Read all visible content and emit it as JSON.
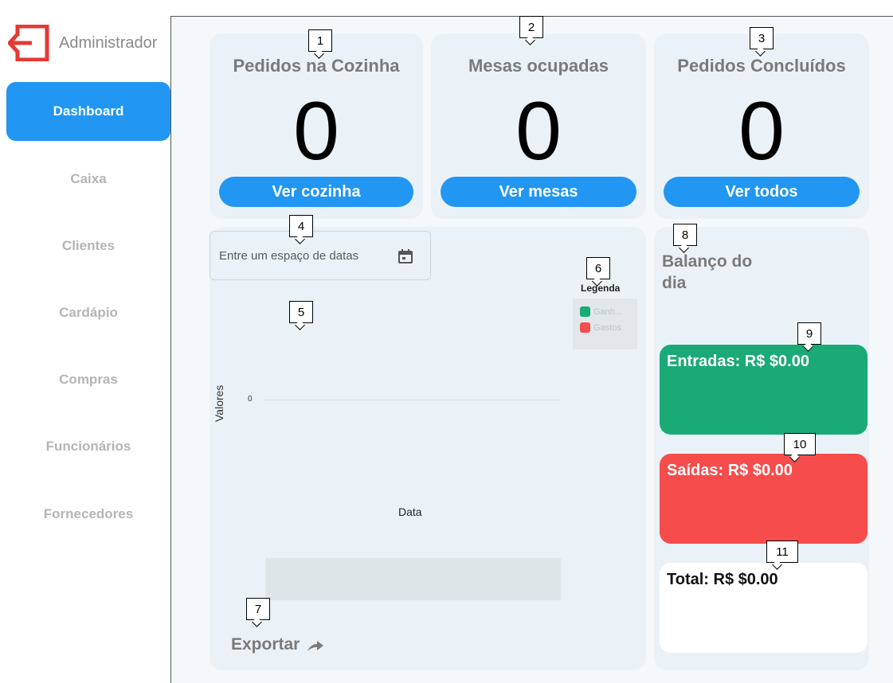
{
  "sidebar": {
    "title": "Administrador",
    "items": [
      {
        "label": "Dashboard",
        "active": true
      },
      {
        "label": "Caixa"
      },
      {
        "label": "Clientes"
      },
      {
        "label": "Cardápio"
      },
      {
        "label": "Compras"
      },
      {
        "label": "Funcionários"
      },
      {
        "label": "Fornecedores"
      }
    ],
    "icon": "logout-icon"
  },
  "cards": [
    {
      "title": "Pedidos na Cozinha",
      "value": "0",
      "button": "Ver cozinha"
    },
    {
      "title": "Mesas ocupadas",
      "value": "0",
      "button": "Ver mesas"
    },
    {
      "title": "Pedidos Concluídos",
      "value": "0",
      "button": "Ver todos"
    }
  ],
  "chart": {
    "date_placeholder": "Entre um espaço de datas",
    "legend_title": "Legenda",
    "legend": [
      {
        "label": "Ganh...",
        "color": "#1aaa76"
      },
      {
        "label": "Gastos",
        "color": "#f74c4c"
      }
    ],
    "ylabel": "Valores",
    "y_tick": "0",
    "xlabel": "Data",
    "export_label": "Exportar"
  },
  "balance": {
    "title": "Balanço do dia",
    "entradas": "Entradas: R$ $0.00",
    "saidas": "Saídas: R$ $0.00",
    "total": "Total: R$ $0.00"
  },
  "callouts": [
    "1",
    "2",
    "3",
    "4",
    "5",
    "6",
    "7",
    "8",
    "9",
    "10",
    "11"
  ],
  "colors": {
    "accent": "#2196f3",
    "income": "#1aaa76",
    "expense": "#f74c4c",
    "logout": "#e53935"
  }
}
